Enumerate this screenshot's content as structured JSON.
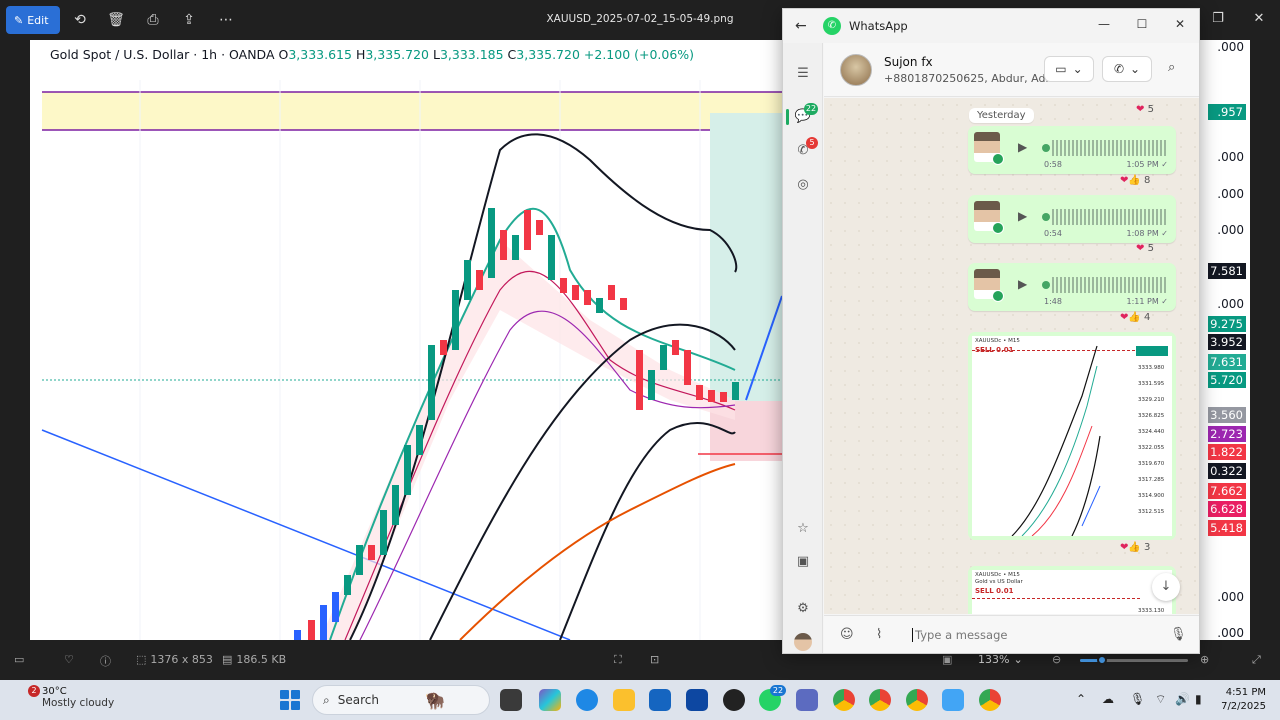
{
  "photos": {
    "edit_label": "Edit",
    "file_title": "XAUUSD_2025-07-02_15-05-49.png",
    "dimensions": "1376 x 853",
    "file_size": "186.5 KB",
    "zoom": "133%",
    "zoom_level": 0.2
  },
  "chart": {
    "symbol": "Gold Spot / U.S. Dollar · 1h · OANDA",
    "o_label": "O",
    "o_value": "3,333.615",
    "h_label": "H",
    "h_value": "3,335.720",
    "l_label": "L",
    "l_value": "3,333.185",
    "c_label": "C",
    "c_value": "3,335.720",
    "change": "+2.100 (+0.06%)",
    "axis_labels": [
      ".000",
      ".000",
      ".000",
      ".000",
      ".000",
      ".000",
      ".000"
    ],
    "axis_labels_lower": [
      ".000",
      ".000"
    ],
    "price_tags": [
      {
        "text": ".957",
        "color": "#089981"
      },
      {
        "text": "7.581",
        "color": "#131722"
      },
      {
        "text": "9.275",
        "color": "#089981"
      },
      {
        "text": "3.952",
        "color": "#131722"
      },
      {
        "text": "7.631",
        "color": "#22ab94"
      },
      {
        "text": "5.720",
        "color": "#089981"
      },
      {
        "text": "3.560",
        "color": "#9598a1"
      },
      {
        "text": "2.723",
        "color": "#9c27b0"
      },
      {
        "text": "1.822",
        "color": "#f23645"
      },
      {
        "text": "0.322",
        "color": "#131722"
      },
      {
        "text": "7.662",
        "color": "#f23645"
      },
      {
        "text": "6.628",
        "color": "#e91e63"
      },
      {
        "text": "5.418",
        "color": "#f23645"
      }
    ]
  },
  "whatsapp": {
    "app_title": "WhatsApp",
    "contact_name": "Sujon fx",
    "contact_sub": "+8801870250625, Abdur, Adna...",
    "rail_badges": {
      "chats": "22",
      "calls": "5"
    },
    "date_chip": "Yesterday",
    "messages": [
      {
        "duration": "0:58",
        "time": "1:05 PM ✓",
        "reactions": "👍",
        "count": "8"
      },
      {
        "duration": "0:54",
        "time": "1:08 PM ✓",
        "reactions": "",
        "count": "5"
      },
      {
        "duration": "1:48",
        "time": "1:11 PM ✓",
        "reactions": "👍",
        "count": "4"
      }
    ],
    "top_reaction_count": "5",
    "image_reaction_count": "3",
    "image_thumb_title": "XAUUSDc • M15",
    "image_thumb_sub": "Gold vs US Dollar",
    "image_thumb_sell": "SELL 0.01",
    "image_thumb_prices": [
      "3333.980",
      "3331.595",
      "3329.210",
      "3326.825",
      "3324.440",
      "3322.055",
      "3319.670",
      "3317.285",
      "3314.900",
      "3312.515"
    ],
    "image_thumb_price2": "3333.130",
    "input_placeholder": "Type a message"
  },
  "taskbar": {
    "temp": "30°C",
    "condition": "Mostly cloudy",
    "weather_badge": "2",
    "search_label": "Search",
    "time": "4:51 PM",
    "date": "7/2/2025",
    "wa_badge": "22"
  }
}
